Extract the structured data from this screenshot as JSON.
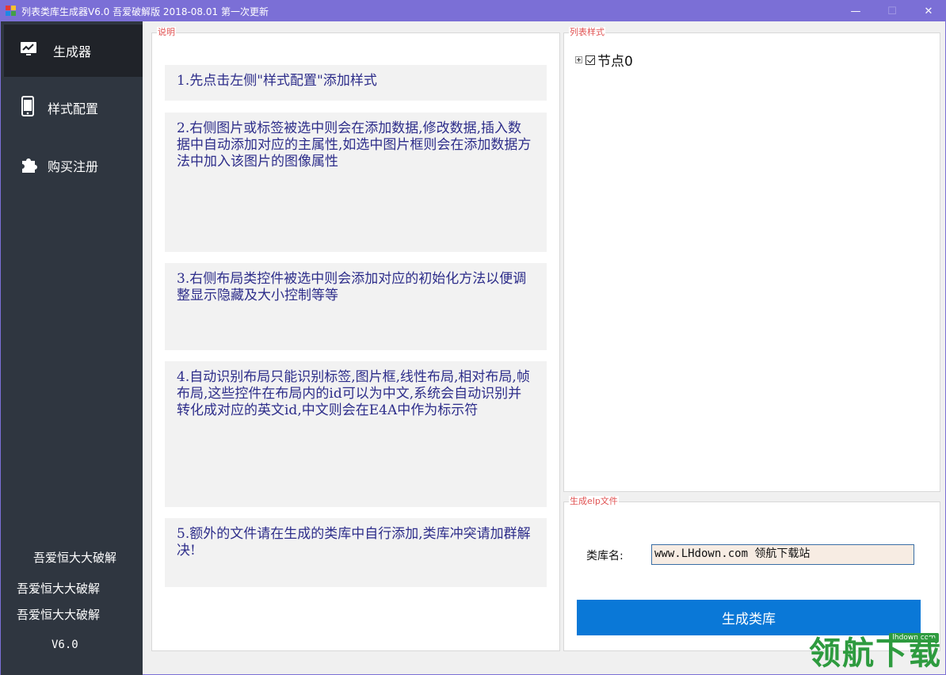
{
  "window": {
    "title": "列表类库生成器V6.0 吾爱破解版 2018-08.01 第一次更新",
    "minimize_glyph": "—",
    "maximize_glyph": "☐",
    "close_glyph": "✕"
  },
  "sidebar": {
    "items": [
      {
        "label": "生成器",
        "icon": "chart-monitor-icon",
        "active": true
      },
      {
        "label": "样式配置",
        "icon": "phone-icon",
        "active": false
      },
      {
        "label": "购买注册",
        "icon": "puzzle-icon",
        "active": false
      }
    ],
    "footer_lines": [
      "吾爱恒大大破解",
      "吾爱恒大大破解",
      "吾爱恒大大破解"
    ],
    "version": "V6.0"
  },
  "instructions": {
    "title": "说明",
    "cards": [
      "1.先点击左侧\"样式配置\"添加样式",
      "2.右侧图片或标签被选中则会在添加数据,修改数据,插入数据中自动添加对应的主属性,如选中图片框则会在添加数据方法中加入该图片的图像属性",
      "3.右侧布局类控件被选中则会添加对应的初始化方法以便调整显示隐藏及大小控制等等",
      "4.自动识别布局只能识别标签,图片框,线性布局,相对布局,帧布局,这些控件在布局内的id可以为中文,系统会自动识别并转化成对应的英文id,中文则会在E4A中作为标示符",
      "5.额外的文件请在生成的类库中自行添加,类库冲突请加群解决!"
    ]
  },
  "list_style": {
    "title": "列表样式",
    "tree_node": "节点0"
  },
  "generate": {
    "title": "生成elp文件",
    "lib_name_label": "类库名:",
    "lib_name_value": "www.LHdown.com  领航下载站",
    "button_label": "生成类库"
  },
  "watermark": {
    "small": "lhdown.com",
    "big": "领航下载"
  },
  "colors": {
    "titlebar": "#7b6fd6",
    "sidebar": "#2f3640",
    "accent_button": "#0a78d7",
    "group_title": "#e05252",
    "card_text": "#2d2d8a"
  }
}
